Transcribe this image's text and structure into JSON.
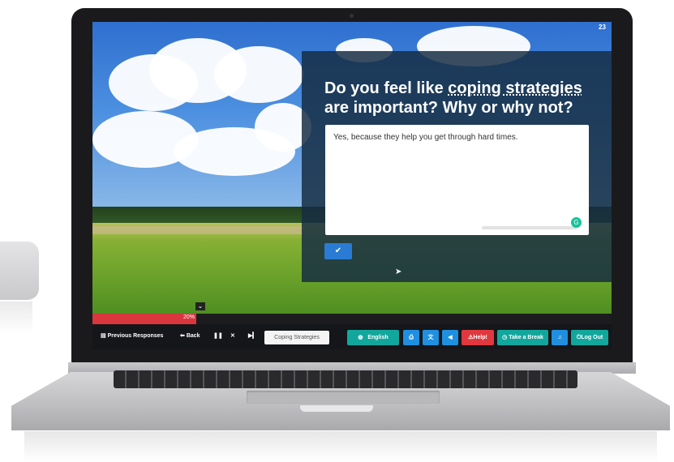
{
  "slide": {
    "number": "23"
  },
  "question": {
    "line1_pre": "Do you feel like ",
    "line1_link": "coping strategies",
    "line2": "are important? Why or why not?"
  },
  "answer": {
    "value": "Yes, because they help you get through hard times."
  },
  "submit": {
    "icon": "check-icon"
  },
  "progress": {
    "percent": 0.2,
    "label": "20%"
  },
  "toolbar": {
    "previous_responses": "Previous Responses",
    "back": "Back",
    "course": "Coping Strategies",
    "language": "English",
    "help": "Help!",
    "take_break": "Take a Break",
    "log_out": "Log Out"
  },
  "colors": {
    "teal": "#12a79d",
    "blue": "#1f8fe0",
    "red": "#e0383e",
    "progress": "#d9363e",
    "panel": "#162c42"
  }
}
